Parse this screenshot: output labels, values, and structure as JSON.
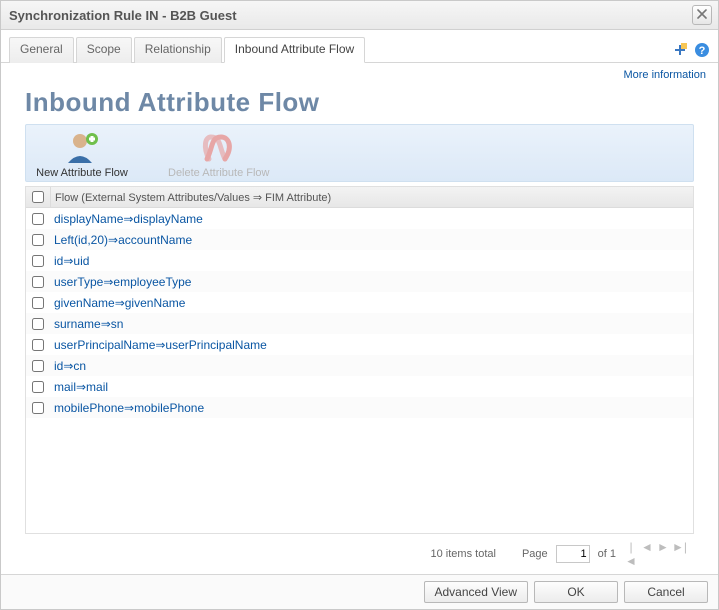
{
  "window": {
    "title": "Synchronization Rule IN - B2B Guest"
  },
  "tabs": {
    "general": "General",
    "scope": "Scope",
    "relationship": "Relationship",
    "inbound": "Inbound Attribute Flow"
  },
  "moreInfo": "More information",
  "page": {
    "heading": "Inbound Attribute Flow"
  },
  "actions": {
    "newFlow": "New Attribute Flow",
    "deleteFlow": "Delete Attribute Flow"
  },
  "grid": {
    "header": "Flow (External System Attributes/Values ⇒ FIM Attribute)",
    "rows": [
      "displayName⇒displayName",
      "Left(id,20)⇒accountName",
      "id⇒uid",
      "userType⇒employeeType",
      "givenName⇒givenName",
      "surname⇒sn",
      "userPrincipalName⇒userPrincipalName",
      "id⇒cn",
      "mail⇒mail",
      "mobilePhone⇒mobilePhone"
    ]
  },
  "pager": {
    "totalText": "10 items total",
    "pageLabel": "Page",
    "pageValue": "1",
    "ofText": "of 1"
  },
  "footer": {
    "advanced": "Advanced View",
    "ok": "OK",
    "cancel": "Cancel"
  }
}
